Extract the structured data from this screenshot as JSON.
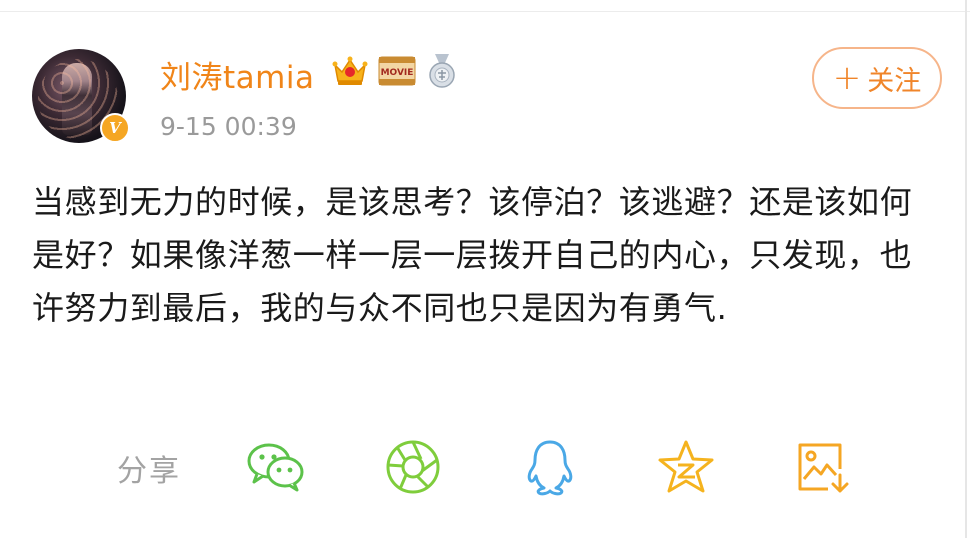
{
  "user": {
    "name": "刘涛tamia",
    "timestamp": "9-15 00:39",
    "verified_mark": "V",
    "badges": [
      "crown-icon",
      "movie-badge-icon",
      "medal-icon"
    ],
    "movie_badge_text": "MOVIE"
  },
  "follow": {
    "plus": "+",
    "label": "关注"
  },
  "post": {
    "text": "当感到无力的时候，是该思考？该停泊？该逃避？还是该如何是好？如果像洋葱一样一层一层拨开自己的内心，只发现，也许努力到最后，我的与众不同也只是因为有勇气."
  },
  "share": {
    "label": "分享",
    "targets": [
      "wechat-icon",
      "moments-icon",
      "qq-icon",
      "qzone-icon",
      "save-image-icon"
    ]
  },
  "colors": {
    "accent": "#f08519",
    "wechat": "#5cc24a",
    "moments": "#7fcd3c",
    "qq": "#4aa8e6",
    "qzone": "#f5b31e",
    "save": "#f5a623"
  }
}
